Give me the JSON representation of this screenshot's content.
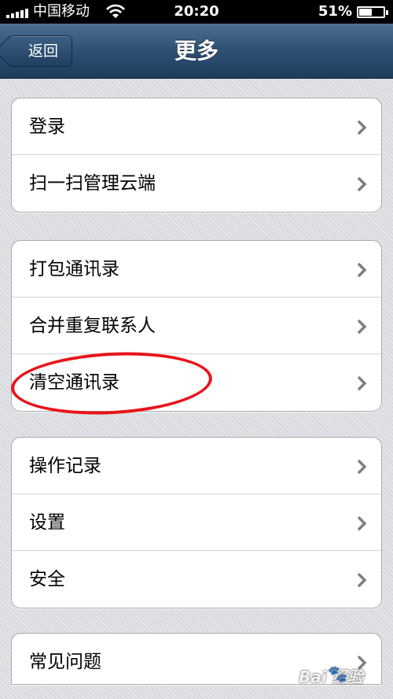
{
  "status_bar": {
    "carrier": "中国移动",
    "time": "20:20",
    "battery_percent": "51%",
    "battery_level": 0.51,
    "signal_icon": "signal-bars-icon",
    "wifi_icon": "wifi-icon",
    "battery_icon": "battery-icon"
  },
  "nav": {
    "back_label": "返回",
    "title": "更多"
  },
  "groups": [
    {
      "rows": [
        {
          "label": "登录"
        },
        {
          "label": "扫一扫管理云端"
        }
      ]
    },
    {
      "rows": [
        {
          "label": "打包通讯录"
        },
        {
          "label": "合并重复联系人"
        },
        {
          "label": "清空通讯录"
        }
      ]
    },
    {
      "rows": [
        {
          "label": "操作记录"
        },
        {
          "label": "设置"
        },
        {
          "label": "安全"
        }
      ]
    },
    {
      "rows": [
        {
          "label": "常见问题"
        }
      ]
    }
  ],
  "annotation": {
    "color": "#e8141b",
    "target": "清空通讯录"
  },
  "watermark": {
    "text": "Bai 经验",
    "icon": "baidu-paw-icon"
  },
  "colors": {
    "nav_top": "#4d6f93",
    "nav_bottom": "#1e3d5e",
    "background": "#dcdee2",
    "chevron": "#7d7f83"
  }
}
